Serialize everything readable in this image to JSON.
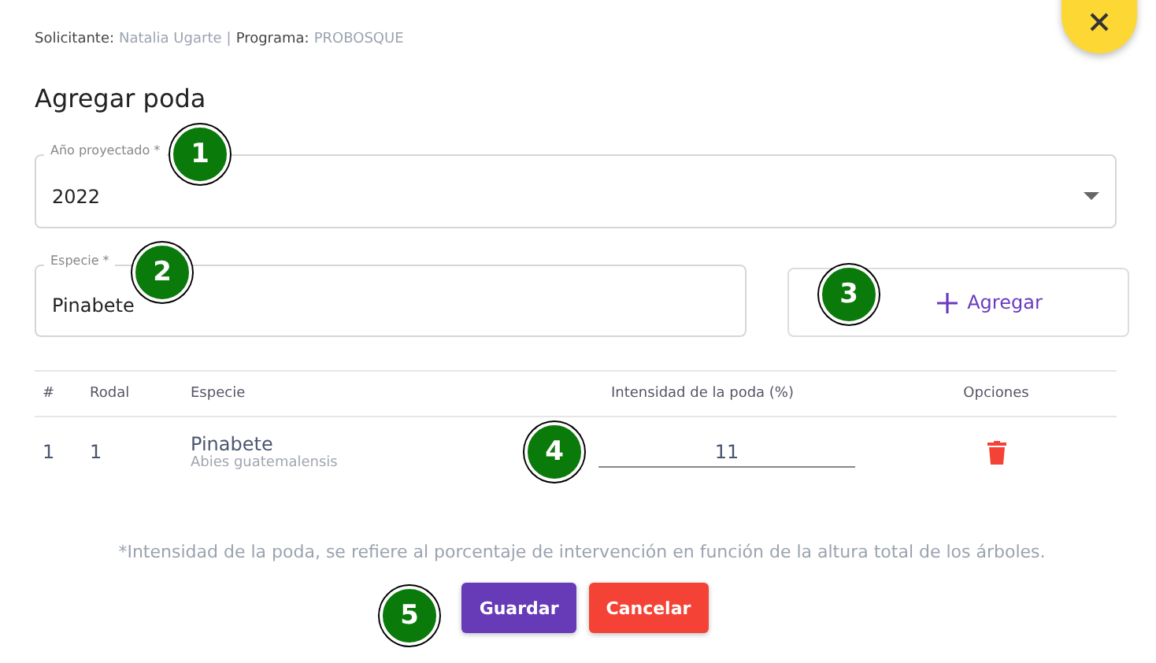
{
  "header": {
    "applicant_label": "Solicitante:",
    "applicant": "Natalia Ugarte",
    "separator": "|",
    "program_label": "Programa:",
    "program": "PROBOSQUE"
  },
  "title": "Agregar poda",
  "year_field": {
    "label": "Año proyectado *",
    "value": "2022"
  },
  "species_field": {
    "label": "Especie *",
    "value": "Pinabete"
  },
  "add_button": {
    "label": "Agregar"
  },
  "table": {
    "columns": [
      "#",
      "Rodal",
      "Especie",
      "Intensidad de la poda (%)",
      "Opciones"
    ],
    "rows": [
      {
        "index": "1",
        "stand": "1",
        "species": "Pinabete",
        "scientific_name": "Abies guatemalensis",
        "intensity": "11"
      }
    ]
  },
  "footnote": "*Intensidad de la poda, se refiere al porcentaje de intervención en función de la altura total de los árboles.",
  "buttons": [
    {
      "label": "Guardar",
      "kind": "primary"
    },
    {
      "label": "Cancelar",
      "kind": "danger"
    }
  ],
  "callouts": [
    "1",
    "2",
    "3",
    "4",
    "5"
  ]
}
